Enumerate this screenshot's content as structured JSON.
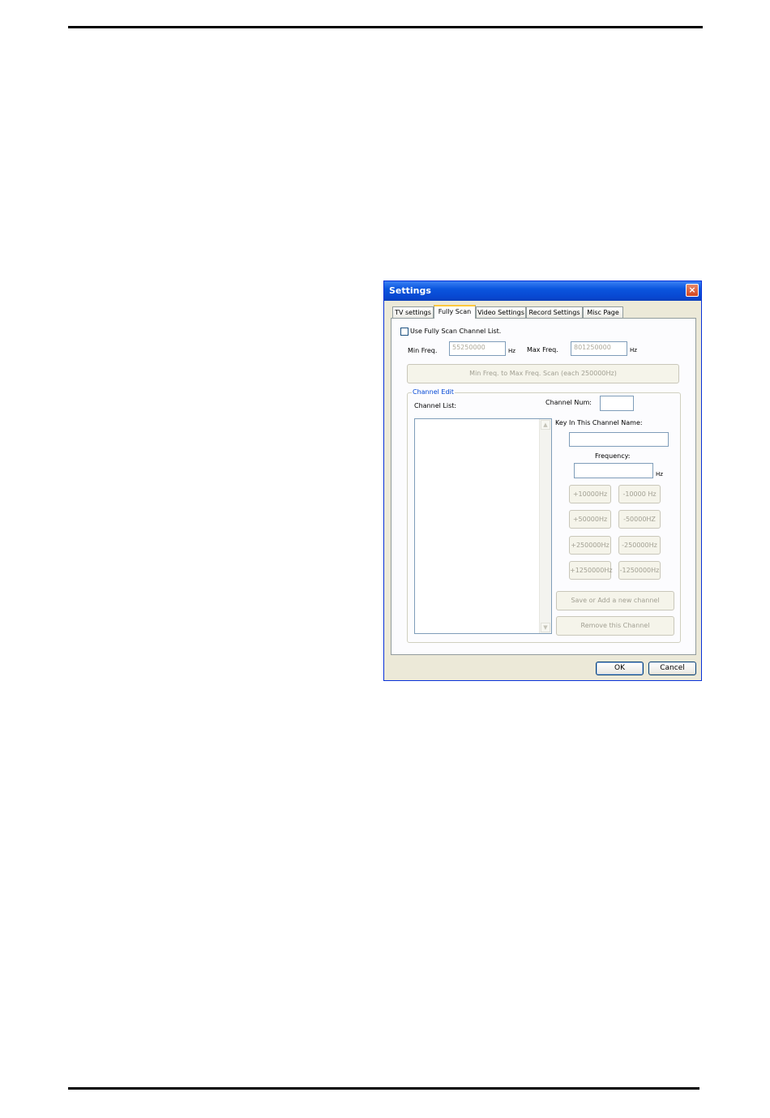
{
  "dialog": {
    "title": "Settings",
    "close_glyph": "×",
    "tabs": [
      {
        "label": "TV settings"
      },
      {
        "label": "Fully Scan"
      },
      {
        "label": "Video Settings"
      },
      {
        "label": "Record Settings"
      },
      {
        "label": "Misc Page"
      }
    ],
    "active_tab": "Fully Scan",
    "fully_scan": {
      "use_list_label": "Use Fully Scan Channel List.",
      "min_freq_label": "Min Freq.",
      "min_freq_value": "55250000",
      "max_freq_label": "Max Freq.",
      "max_freq_value": "801250000",
      "hz_unit": "Hz",
      "scan_button": "Min Freq. to Max Freq. Scan (each 250000Hz)"
    },
    "channel_edit": {
      "group_label": "Channel Edit",
      "channel_list_label": "Channel List:",
      "channel_num_label": "Channel Num:",
      "channel_num_value": "",
      "channel_name_label": "Key In This Channel Name:",
      "channel_name_value": "",
      "frequency_label": "Frequency:",
      "frequency_value": "",
      "hz_unit": "Hz",
      "step_buttons": {
        "plus_10000": "+10000Hz",
        "minus_10000": "-10000 Hz",
        "plus_50000": "+50000Hz",
        "minus_50000": "-50000HZ",
        "plus_250000": "+250000Hz",
        "minus_250000": "-250000Hz",
        "plus_1250000": "+1250000Hz",
        "minus_1250000": "-1250000Hz"
      },
      "save_button": "Save or Add a new channel",
      "remove_button": "Remove this Channel"
    },
    "footer": {
      "ok": "OK",
      "cancel": "Cancel"
    }
  },
  "colors": {
    "titlebar": "#0a55de",
    "dialog_bg": "#ece9d8",
    "group_label": "#0046d5",
    "disabled_text": "#a19f92"
  }
}
